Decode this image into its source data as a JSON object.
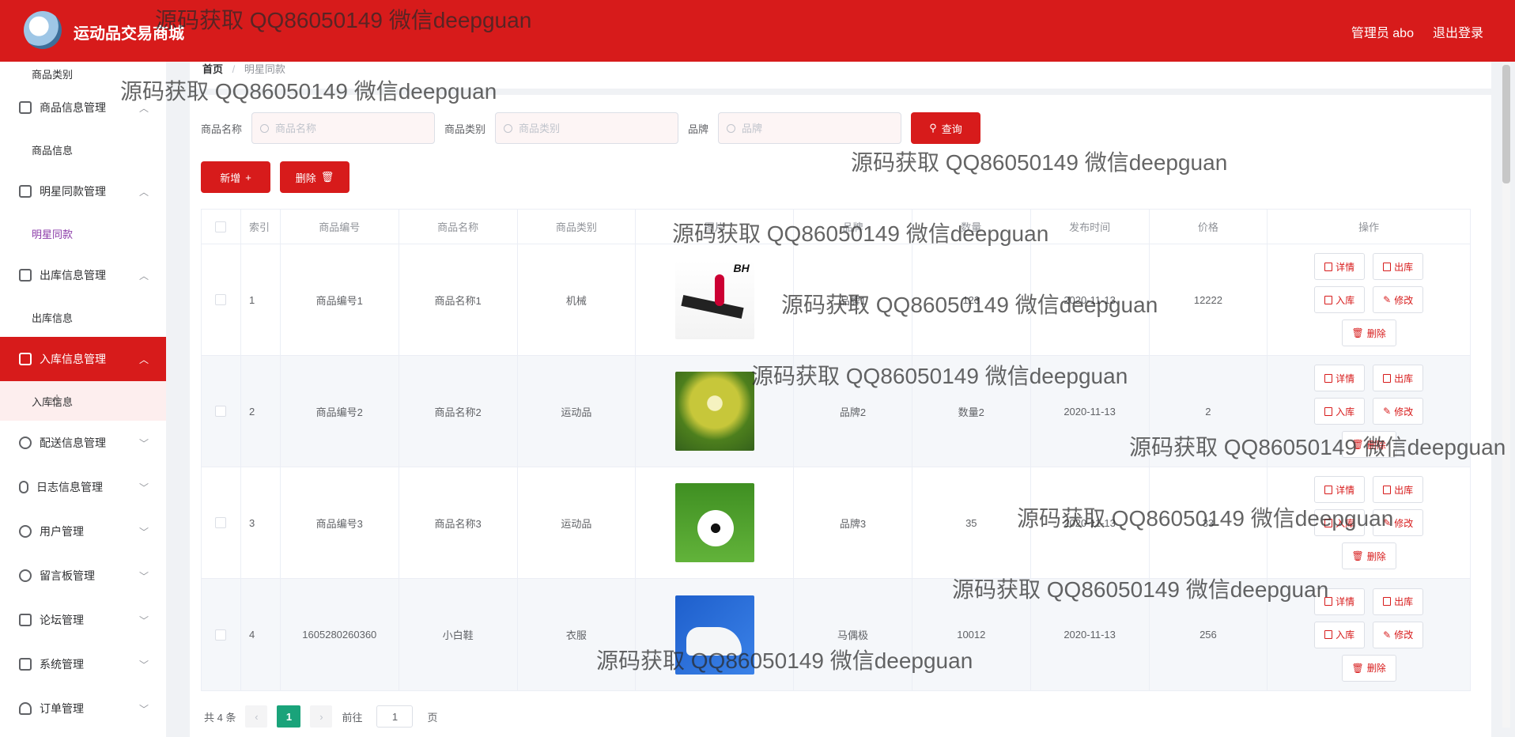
{
  "app": {
    "title": "运动品交易商城",
    "user_label": "管理员 abo",
    "logout_label": "退出登录"
  },
  "sidebar": {
    "top_item": "商品类别",
    "groups": [
      {
        "label": "商品信息管理",
        "icon": "bar-chart-icon",
        "children": [
          "商品信息"
        ]
      },
      {
        "label": "明星同款管理",
        "icon": "copy-icon",
        "children": [
          "明星同款"
        ]
      },
      {
        "label": "出库信息管理",
        "icon": "bar-chart-icon",
        "children": [
          "出库信息"
        ]
      },
      {
        "label": "入库信息管理",
        "icon": "briefcase-icon",
        "children": [
          "入库信息"
        ]
      },
      {
        "label": "配送信息管理",
        "icon": "target-icon"
      },
      {
        "label": "日志信息管理",
        "icon": "microphone-icon"
      },
      {
        "label": "用户管理",
        "icon": "circle-icon"
      },
      {
        "label": "留言板管理",
        "icon": "compass-icon"
      },
      {
        "label": "论坛管理",
        "icon": "clipboard-icon"
      },
      {
        "label": "系统管理",
        "icon": "list-icon"
      },
      {
        "label": "订单管理",
        "icon": "bulb-icon"
      }
    ]
  },
  "breadcrumb": {
    "home": "首页",
    "separator": "/",
    "current": "明星同款"
  },
  "search": {
    "name_label": "商品名称",
    "name_placeholder": "商品名称",
    "category_label": "商品类别",
    "category_placeholder": "商品类别",
    "brand_label": "品牌",
    "brand_placeholder": "品牌",
    "query_label": "查询"
  },
  "actions": {
    "add_label": "新增",
    "add_icon": "+",
    "delete_label": "删除",
    "delete_icon": "🗑"
  },
  "table": {
    "headers": [
      "索引",
      "商品编号",
      "商品名称",
      "商品类别",
      "图片",
      "品牌",
      "数量",
      "发布时间",
      "价格",
      "操作"
    ],
    "rows": [
      {
        "index": "1",
        "code": "商品编号1",
        "name": "商品名称1",
        "category": "机械",
        "brand": "品牌1",
        "qty": "123",
        "time": "2020-11-13",
        "price": "12222",
        "image": "treadmill",
        "image_text": "BH"
      },
      {
        "index": "2",
        "code": "商品编号2",
        "name": "商品名称2",
        "category": "运动品",
        "brand": "品牌2",
        "qty": "数量2",
        "time": "2020-11-13",
        "price": "2",
        "image": "badminton"
      },
      {
        "index": "3",
        "code": "商品编号3",
        "name": "商品名称3",
        "category": "运动品",
        "brand": "品牌3",
        "qty": "35",
        "time": "2020-11-13",
        "price": "33",
        "image": "soccer-ball"
      },
      {
        "index": "4",
        "code": "1605280260360",
        "name": "小白鞋",
        "category": "衣服",
        "brand": "马偶极",
        "qty": "10012",
        "time": "2020-11-13",
        "price": "256",
        "image": "white-sneaker"
      }
    ],
    "ops": {
      "detail": "详情",
      "out": "出库",
      "in": "入库",
      "edit": "修改",
      "delete": "删除"
    }
  },
  "pagination": {
    "total_text": "共 4 条",
    "prev": "‹",
    "current_page": "1",
    "next": "›",
    "goto_prefix": "前往",
    "goto_value": "1",
    "goto_suffix": "页"
  },
  "watermark": "源码获取 QQ86050149 微信deepguan",
  "colors": {
    "primary": "#d71b1b",
    "pager_active": "#1aa37a",
    "current_sub": "#8b3aa8"
  }
}
